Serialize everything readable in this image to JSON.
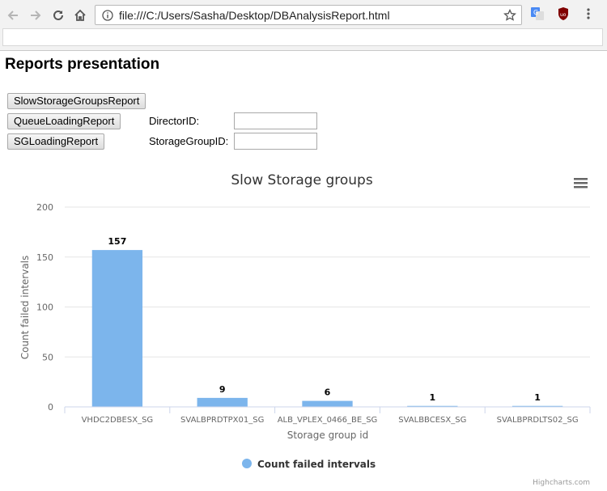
{
  "browser": {
    "url": "file:///C:/Users/Sasha/Desktop/DBAnalysisReport.html"
  },
  "page": {
    "title": "Reports presentation",
    "buttons": {
      "slow_storage": "SlowStorageGroupsReport",
      "queue_loading": "QueueLoadingReport",
      "sg_loading": "SGLoadingReport"
    },
    "director_label": "DirectorID:",
    "director_value": "",
    "storage_group_label": "StorageGroupID:",
    "storage_group_value": ""
  },
  "chart_data": {
    "type": "bar",
    "title": "Slow Storage groups",
    "xlabel": "Storage group id",
    "ylabel": "Count failed intervals",
    "categories": [
      "VHDC2DBESX_SG",
      "SVALBPRDTPX01_SG",
      "ALB_VPLEX_0466_BE_SG",
      "SVALBBCESX_SG",
      "SVALBPRDLTS02_SG"
    ],
    "series": [
      {
        "name": "Count failed intervals",
        "values": [
          157,
          9,
          6,
          1,
          1
        ]
      }
    ],
    "ylim": [
      0,
      200
    ],
    "yticks": [
      0,
      50,
      100,
      150,
      200
    ],
    "grid": true,
    "legend": "bottom-center",
    "color": "#7cb5ec",
    "credits": "Highcharts.com"
  }
}
